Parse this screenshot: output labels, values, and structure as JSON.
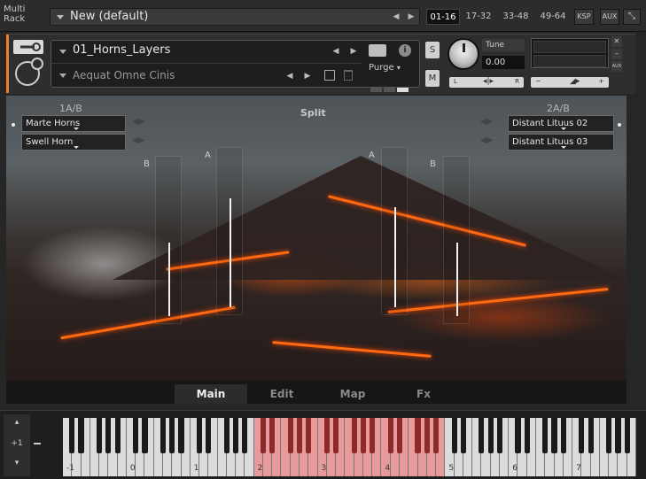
{
  "topbar": {
    "multi_rack_label": "Multi\nRack",
    "rack_name": "New (default)",
    "pages": [
      "01-16",
      "17-32",
      "33-48",
      "49-64"
    ],
    "active_page": "01-16",
    "ksp_label": "KSP",
    "aux_label": "AUX"
  },
  "instrument": {
    "name": "01_Horns_Layers",
    "preset": "Aequat Omne Cinis",
    "purge_label": "Purge",
    "solo_label": "S",
    "mute_label": "M",
    "tune_label": "Tune",
    "tune_value": "0.00",
    "pan_left": "L",
    "pan_right": "R",
    "vol_minus": "−",
    "vol_plus": "+",
    "aux_label": "AUX"
  },
  "main": {
    "group_left": "1A/B",
    "group_right": "2A/B",
    "split_label": "Split",
    "slots_left": [
      "Marte Horns",
      "Swell Horn"
    ],
    "slots_right": [
      "Distant Lituus 02",
      "Distant Lituus 03"
    ],
    "column_labels": [
      "B",
      "A",
      "A",
      "B"
    ],
    "fader_levels": [
      0.55,
      0.82,
      0.75,
      0.55
    ],
    "tabs": [
      "Main",
      "Edit",
      "Map",
      "Fx"
    ],
    "active_tab": "Main"
  },
  "keyboard": {
    "octave_value": "+1",
    "octave_labels": [
      "-1",
      "0",
      "1",
      "2",
      "3",
      "4",
      "5",
      "6",
      "7"
    ],
    "selected_range_octaves": "2-4",
    "selected_color": "#e89a9a"
  },
  "colors": {
    "accent": "#e8832b",
    "lava": "#ff6a12"
  }
}
